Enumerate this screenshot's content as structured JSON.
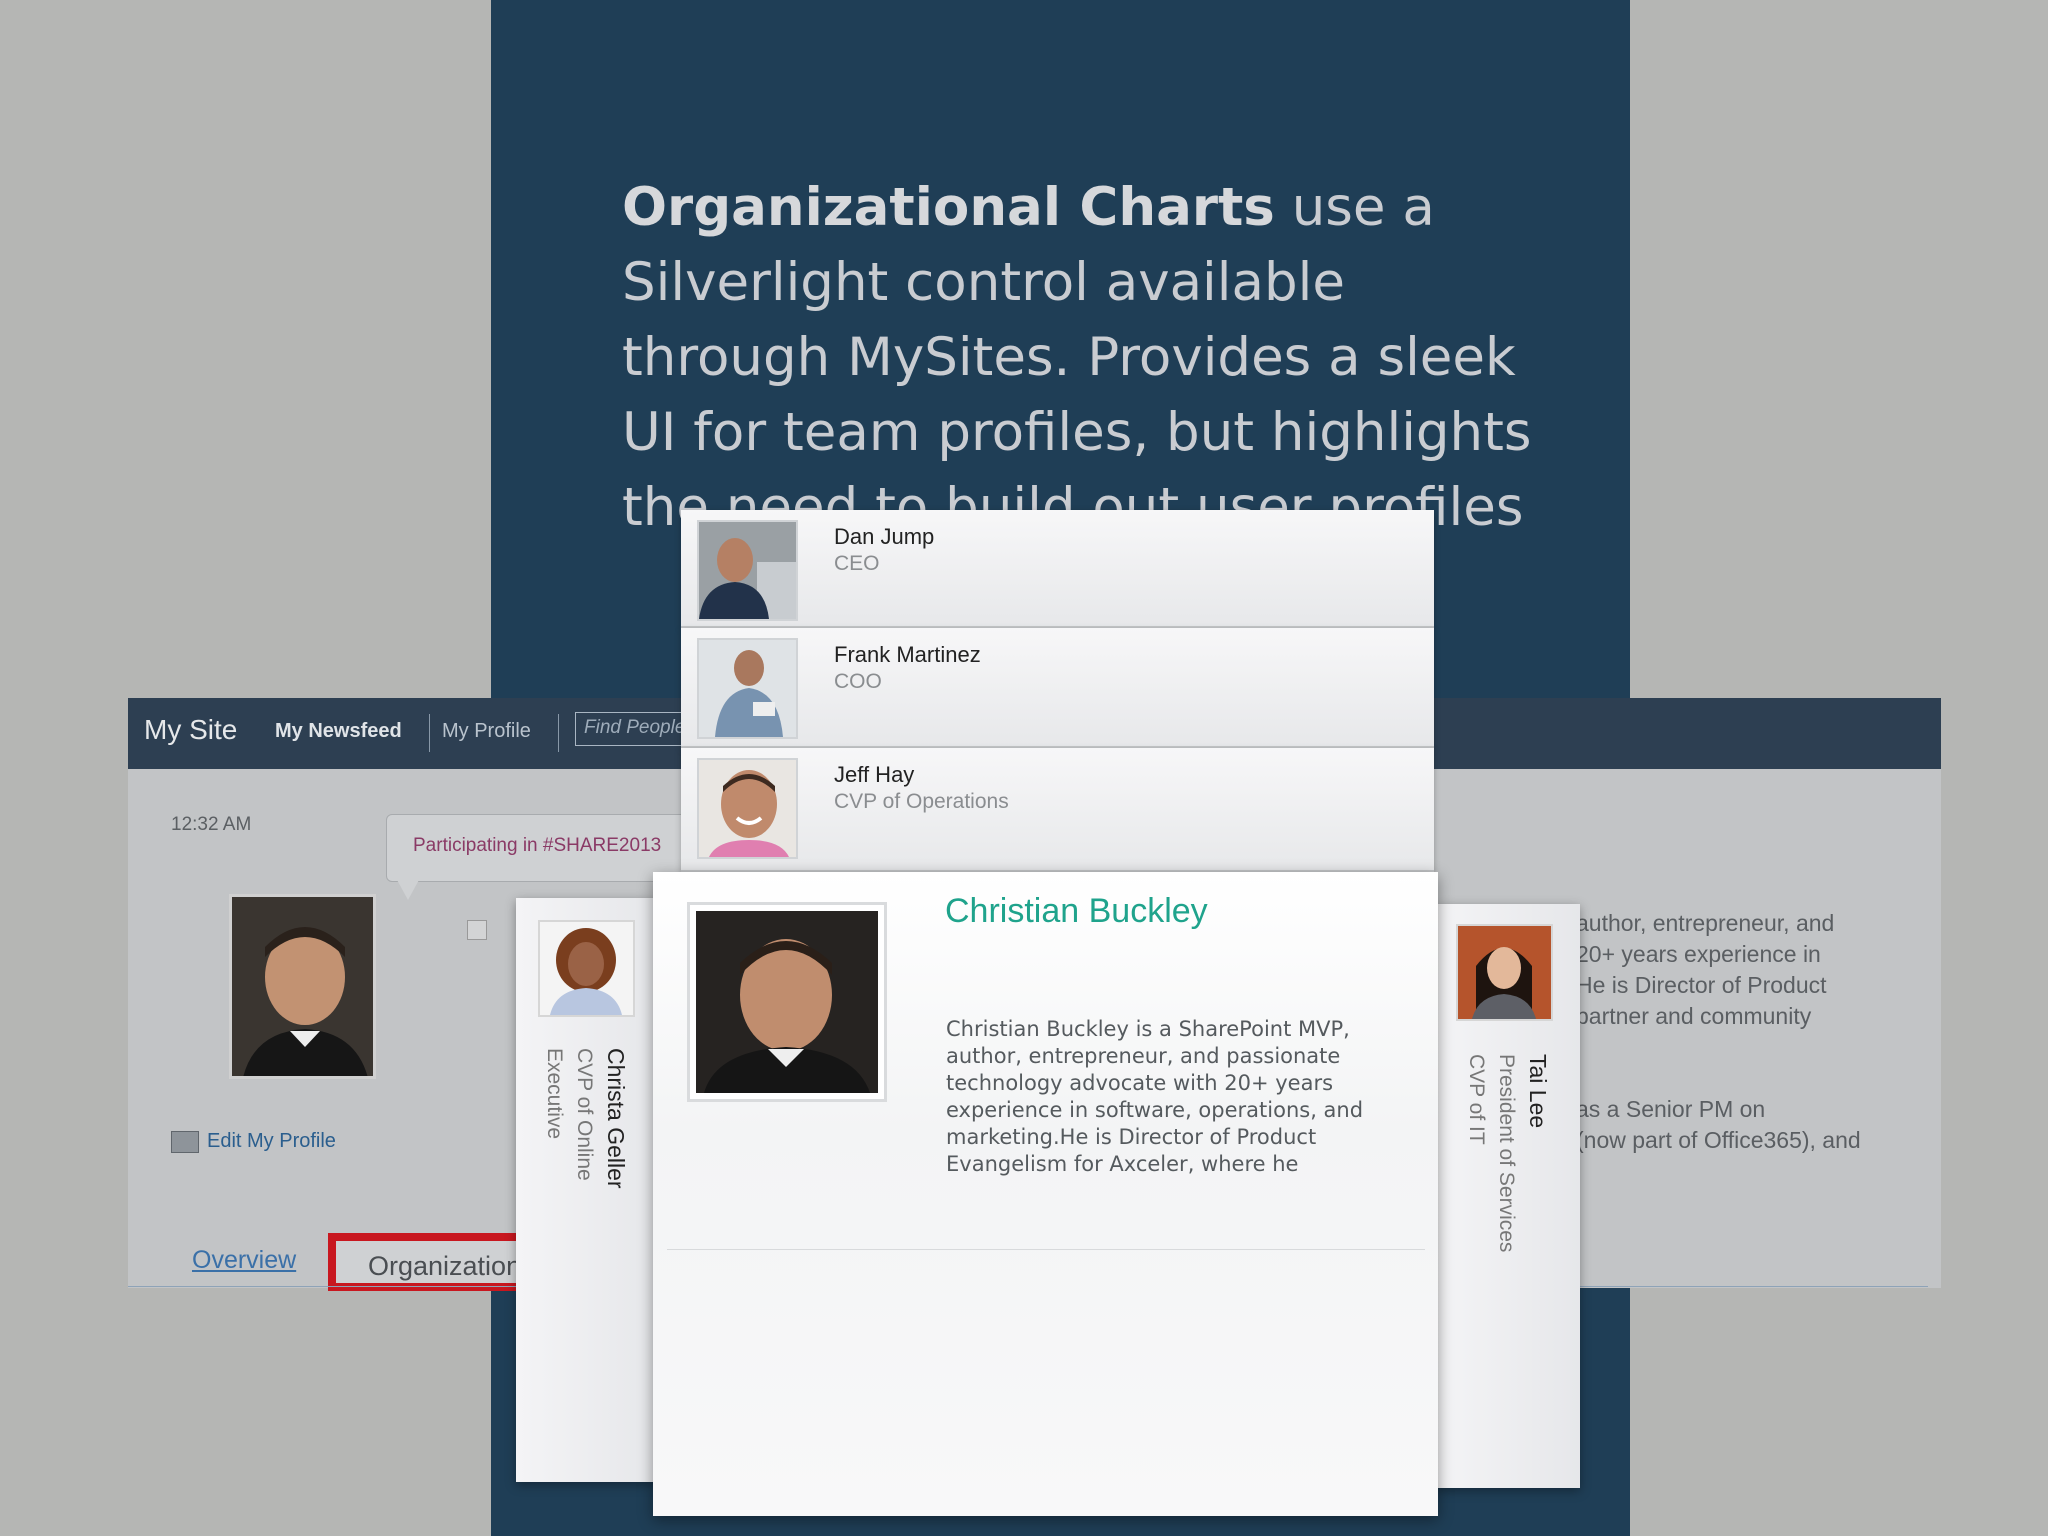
{
  "slide": {
    "headline_bold": "Organizational Charts",
    "headline_rest": " use a Silverlight control available through MySites. Provides a sleek UI for team profiles, but highlights the need to build out user profiles"
  },
  "mysite": {
    "brand": "My Site",
    "nav": {
      "newsfeed": "My Newsfeed",
      "profile": "My Profile"
    },
    "search_placeholder": "Find People",
    "time": "12:32 AM",
    "status_bubble": "Participating in #SHARE2013",
    "edit_profile": "Edit My Profile",
    "tabs": {
      "overview": "Overview",
      "organization": "Organization"
    },
    "bio_snippet": [
      "author, entrepreneur, and",
      "20+ years experience in",
      "He is Director of Product",
      "partner and community",
      "",
      "as a Senior PM on",
      "(now part of Office365), and"
    ]
  },
  "orgchart": {
    "managers": [
      {
        "name": "Dan Jump",
        "role": "CEO"
      },
      {
        "name": "Frank Martinez",
        "role": "COO"
      },
      {
        "name": "Jeff Hay",
        "role": "CVP of Operations"
      }
    ],
    "left_peer": {
      "name": "Christa Geller",
      "role1": "CVP of Online",
      "role2": "Executive"
    },
    "right_peer": {
      "name": "Tai Lee",
      "role1": "President of Services",
      "role2": "CVP of IT"
    },
    "focus": {
      "name": "Christian Buckley",
      "bio": "Christian Buckley is a SharePoint MVP, author, entrepreneur, and passionate technology advocate with 20+ years experience in software, operations, and marketing.He is Director of Product Evangelism for Axceler, where he"
    }
  },
  "colors": {
    "accent_teal": "#1fa38c",
    "slide_navy": "#1f3e56",
    "highlight_red": "#c8171f"
  }
}
